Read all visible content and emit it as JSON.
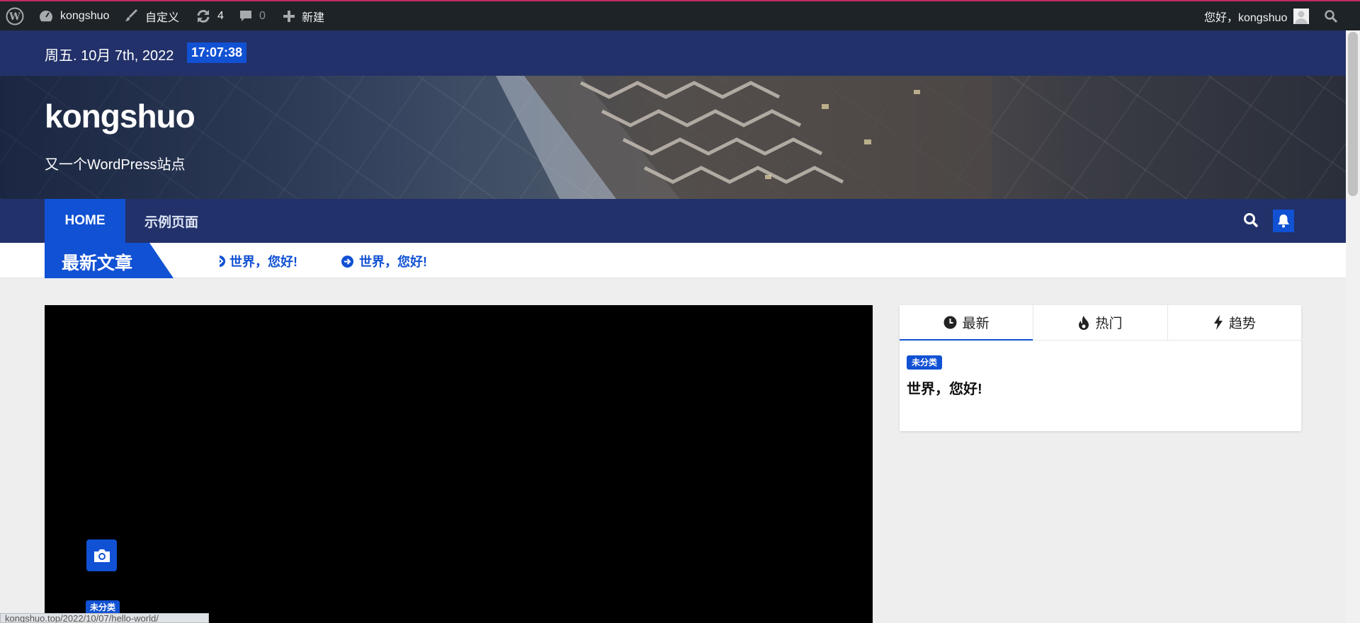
{
  "admin_bar": {
    "site_name": "kongshuo",
    "customize_label": "自定义",
    "updates_count": "4",
    "comments_count": "0",
    "new_label": "新建",
    "greeting": "您好，kongshuo"
  },
  "top_bar": {
    "date": "周五. 10月 7th, 2022",
    "time": "17:07:38"
  },
  "header": {
    "site_title": "kongshuo",
    "site_description": "又一个WordPress站点"
  },
  "nav": {
    "items": [
      {
        "label": "HOME"
      },
      {
        "label": "示例页面"
      }
    ]
  },
  "ticker": {
    "label": "最新文章",
    "items": [
      {
        "label": "世界，您好!"
      },
      {
        "label": "世界，您好!"
      }
    ]
  },
  "featured": {
    "category": "未分类",
    "status_url": "kongshuo.top/2022/10/07/hello-world/"
  },
  "widget": {
    "tabs": [
      {
        "label": "最新",
        "icon": "clock-icon"
      },
      {
        "label": "热门",
        "icon": "fire-icon"
      },
      {
        "label": "趋势",
        "icon": "bolt-icon"
      }
    ],
    "post": {
      "category": "未分类",
      "title": "世界，您好!"
    }
  },
  "colors": {
    "admin_bar_bg": "#1d2327",
    "header_navy": "#22316a",
    "accent_blue": "#1151d3",
    "page_bg": "#eeeeee"
  }
}
